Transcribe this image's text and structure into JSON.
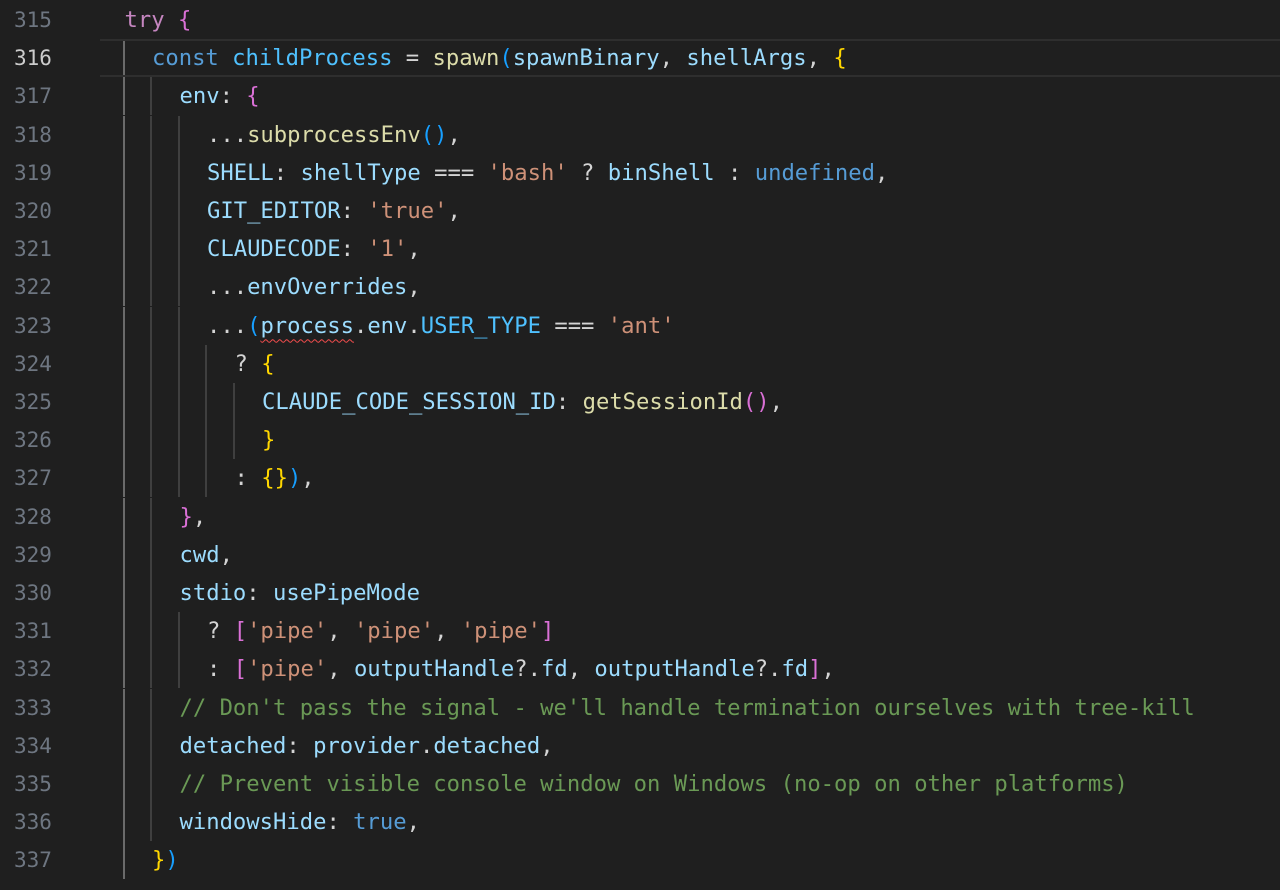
{
  "colors": {
    "background": "#1f1f1f",
    "line_number": "#6e7681",
    "line_number_active": "#cccccc",
    "indent_guide": "#3f3f3f",
    "indent_guide_active": "#6a6a6a",
    "error_squiggle": "#f14c4c",
    "default": "#d4d4d4",
    "keyword_control": "#c586c0",
    "keyword": "#569cd6",
    "function": "#dcdcaa",
    "variable": "#9cdcfe",
    "constant": "#4fc1ff",
    "string": "#ce9178",
    "comment": "#6a9955",
    "bracket_1": "#ffd700",
    "bracket_2": "#da70d6",
    "bracket_3": "#179fff"
  },
  "editor": {
    "active_line": "316",
    "lines": [
      {
        "number": "315",
        "indent": 1,
        "tokens": [
          {
            "t": "try",
            "c": "keyword_control"
          },
          {
            "t": " "
          },
          {
            "t": "{",
            "c": "bracket_2"
          }
        ]
      },
      {
        "number": "316",
        "indent": 2,
        "tokens": [
          {
            "t": "const",
            "c": "keyword"
          },
          {
            "t": " "
          },
          {
            "t": "childProcess",
            "c": "constant"
          },
          {
            "t": " = "
          },
          {
            "t": "spawn",
            "c": "function"
          },
          {
            "t": "(",
            "c": "bracket_3"
          },
          {
            "t": "spawnBinary",
            "c": "variable"
          },
          {
            "t": ", "
          },
          {
            "t": "shellArgs",
            "c": "variable"
          },
          {
            "t": ", "
          },
          {
            "t": "{",
            "c": "bracket_1"
          }
        ]
      },
      {
        "number": "317",
        "indent": 3,
        "tokens": [
          {
            "t": "env",
            "c": "variable"
          },
          {
            "t": ": "
          },
          {
            "t": "{",
            "c": "bracket_2"
          }
        ]
      },
      {
        "number": "318",
        "indent": 4,
        "tokens": [
          {
            "t": "..."
          },
          {
            "t": "subprocessEnv",
            "c": "function"
          },
          {
            "t": "()",
            "c": "bracket_3"
          },
          {
            "t": ","
          }
        ]
      },
      {
        "number": "319",
        "indent": 4,
        "tokens": [
          {
            "t": "SHELL",
            "c": "variable"
          },
          {
            "t": ": "
          },
          {
            "t": "shellType",
            "c": "variable"
          },
          {
            "t": " === "
          },
          {
            "t": "'bash'",
            "c": "string"
          },
          {
            "t": " ? "
          },
          {
            "t": "binShell",
            "c": "variable"
          },
          {
            "t": " : "
          },
          {
            "t": "undefined",
            "c": "keyword"
          },
          {
            "t": ","
          }
        ]
      },
      {
        "number": "320",
        "indent": 4,
        "tokens": [
          {
            "t": "GIT_EDITOR",
            "c": "variable"
          },
          {
            "t": ": "
          },
          {
            "t": "'true'",
            "c": "string"
          },
          {
            "t": ","
          }
        ]
      },
      {
        "number": "321",
        "indent": 4,
        "tokens": [
          {
            "t": "CLAUDECODE",
            "c": "variable"
          },
          {
            "t": ": "
          },
          {
            "t": "'1'",
            "c": "string"
          },
          {
            "t": ","
          }
        ]
      },
      {
        "number": "322",
        "indent": 4,
        "tokens": [
          {
            "t": "..."
          },
          {
            "t": "envOverrides",
            "c": "variable"
          },
          {
            "t": ","
          }
        ]
      },
      {
        "number": "323",
        "indent": 4,
        "tokens": [
          {
            "t": "..."
          },
          {
            "t": "(",
            "c": "bracket_3"
          },
          {
            "t": "process",
            "c": "variable",
            "squiggle": true
          },
          {
            "t": "."
          },
          {
            "t": "env",
            "c": "variable"
          },
          {
            "t": "."
          },
          {
            "t": "USER_TYPE",
            "c": "constant"
          },
          {
            "t": " === "
          },
          {
            "t": "'ant'",
            "c": "string"
          }
        ]
      },
      {
        "number": "324",
        "indent": 5,
        "tokens": [
          {
            "t": "? "
          },
          {
            "t": "{",
            "c": "bracket_1"
          }
        ]
      },
      {
        "number": "325",
        "indent": 6,
        "tokens": [
          {
            "t": "CLAUDE_CODE_SESSION_ID",
            "c": "variable"
          },
          {
            "t": ": "
          },
          {
            "t": "getSessionId",
            "c": "function"
          },
          {
            "t": "()",
            "c": "bracket_2"
          },
          {
            "t": ","
          }
        ]
      },
      {
        "number": "326",
        "indent": 6,
        "tokens": [
          {
            "t": "}",
            "c": "bracket_1"
          }
        ]
      },
      {
        "number": "327",
        "indent": 5,
        "tokens": [
          {
            "t": ": "
          },
          {
            "t": "{}",
            "c": "bracket_1"
          },
          {
            "t": ")",
            "c": "bracket_3"
          },
          {
            "t": ","
          }
        ]
      },
      {
        "number": "328",
        "indent": 3,
        "tokens": [
          {
            "t": "}",
            "c": "bracket_2"
          },
          {
            "t": ","
          }
        ]
      },
      {
        "number": "329",
        "indent": 3,
        "tokens": [
          {
            "t": "cwd",
            "c": "variable"
          },
          {
            "t": ","
          }
        ]
      },
      {
        "number": "330",
        "indent": 3,
        "tokens": [
          {
            "t": "stdio",
            "c": "variable"
          },
          {
            "t": ": "
          },
          {
            "t": "usePipeMode",
            "c": "variable"
          }
        ]
      },
      {
        "number": "331",
        "indent": 4,
        "tokens": [
          {
            "t": "? "
          },
          {
            "t": "[",
            "c": "bracket_2"
          },
          {
            "t": "'pipe'",
            "c": "string"
          },
          {
            "t": ", "
          },
          {
            "t": "'pipe'",
            "c": "string"
          },
          {
            "t": ", "
          },
          {
            "t": "'pipe'",
            "c": "string"
          },
          {
            "t": "]",
            "c": "bracket_2"
          }
        ]
      },
      {
        "number": "332",
        "indent": 4,
        "tokens": [
          {
            "t": ": "
          },
          {
            "t": "[",
            "c": "bracket_2"
          },
          {
            "t": "'pipe'",
            "c": "string"
          },
          {
            "t": ", "
          },
          {
            "t": "outputHandle",
            "c": "variable"
          },
          {
            "t": "?."
          },
          {
            "t": "fd",
            "c": "variable"
          },
          {
            "t": ", "
          },
          {
            "t": "outputHandle",
            "c": "variable"
          },
          {
            "t": "?."
          },
          {
            "t": "fd",
            "c": "variable"
          },
          {
            "t": "]",
            "c": "bracket_2"
          },
          {
            "t": ","
          }
        ]
      },
      {
        "number": "333",
        "indent": 3,
        "tokens": [
          {
            "t": "// Don't pass the signal - we'll handle termination ourselves with tree-kill",
            "c": "comment"
          }
        ]
      },
      {
        "number": "334",
        "indent": 3,
        "tokens": [
          {
            "t": "detached",
            "c": "variable"
          },
          {
            "t": ": "
          },
          {
            "t": "provider",
            "c": "variable"
          },
          {
            "t": "."
          },
          {
            "t": "detached",
            "c": "variable"
          },
          {
            "t": ","
          }
        ]
      },
      {
        "number": "335",
        "indent": 3,
        "tokens": [
          {
            "t": "// Prevent visible console window on Windows (no-op on other platforms)",
            "c": "comment"
          }
        ]
      },
      {
        "number": "336",
        "indent": 3,
        "tokens": [
          {
            "t": "windowsHide",
            "c": "variable"
          },
          {
            "t": ": "
          },
          {
            "t": "true",
            "c": "keyword"
          },
          {
            "t": ","
          }
        ]
      },
      {
        "number": "337",
        "indent": 2,
        "tokens": [
          {
            "t": "}",
            "c": "bracket_1"
          },
          {
            "t": ")",
            "c": "bracket_3"
          }
        ]
      }
    ]
  }
}
